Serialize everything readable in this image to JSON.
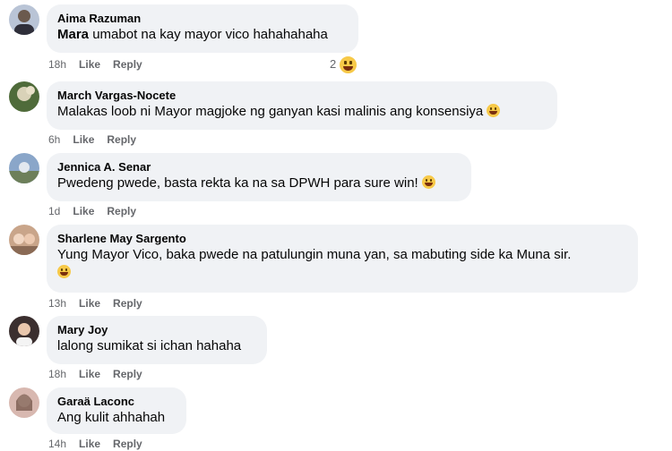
{
  "comments": [
    {
      "name": "Aima Razuman",
      "mention": "Mara",
      "text": " umabot na kay mayor vico hahahahaha",
      "time": "18h",
      "like": "Like",
      "reply": "Reply",
      "reaction_count": "2",
      "avatar_color": "#b9c4d6"
    },
    {
      "name": "March Vargas-Nocete",
      "text": "Malakas loob ni Mayor magjoke ng ganyan kasi malinis ang konsensiya",
      "time": "6h",
      "like": "Like",
      "reply": "Reply",
      "avatar_color": "#4f6b3a"
    },
    {
      "name": "Jennica A. Senar",
      "text": "Pwedeng pwede, basta rekta ka na sa DPWH para sure win!",
      "time": "1d",
      "like": "Like",
      "reply": "Reply",
      "avatar_color": "#8aa6c9"
    },
    {
      "name": "Sharlene May Sargento",
      "text": "Yung Mayor Vico, baka pwede na patulungin muna yan, sa mabuting side ka Muna sir.",
      "time": "13h",
      "like": "Like",
      "reply": "Reply",
      "avatar_color": "#c9a58a"
    },
    {
      "name": "Mary Joy",
      "text": "lalong sumikat si ichan hahaha",
      "time": "18h",
      "like": "Like",
      "reply": "Reply",
      "avatar_color": "#3b2f2f"
    },
    {
      "name": "Garaä Laconc",
      "text": "Ang kulit ahhahah",
      "time": "14h",
      "like": "Like",
      "reply": "Reply",
      "avatar_color": "#d8b8b0"
    }
  ]
}
